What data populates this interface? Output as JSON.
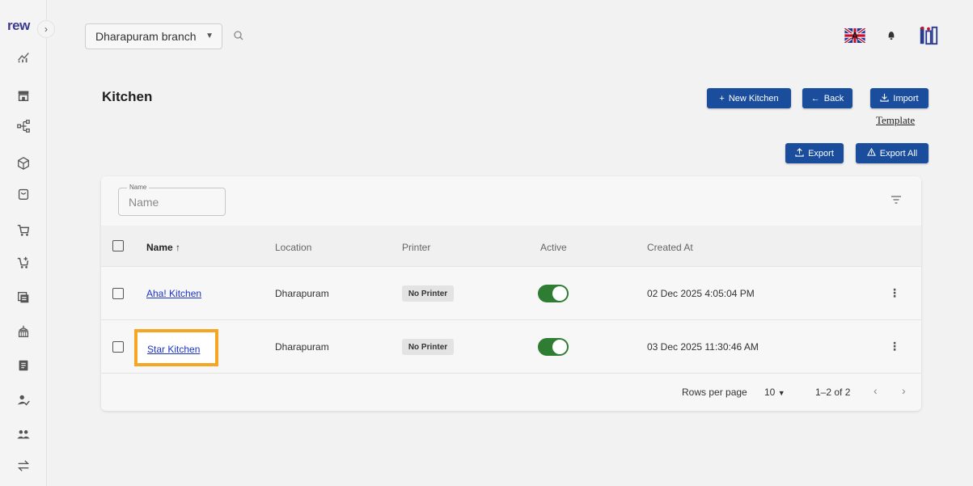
{
  "app": {
    "logo": "rew"
  },
  "sidebar": {
    "expand_icon": "chevron-right-icon",
    "items": [
      {
        "icon": "analytics-icon"
      },
      {
        "icon": "store-icon"
      },
      {
        "icon": "hierarchy-icon"
      },
      {
        "icon": "box-icon"
      },
      {
        "icon": "bag-icon"
      },
      {
        "icon": "cart-icon"
      },
      {
        "icon": "cart-add-icon"
      },
      {
        "icon": "layers-icon"
      },
      {
        "icon": "tiffin-icon"
      },
      {
        "icon": "receipt-icon"
      },
      {
        "icon": "user-check-icon"
      },
      {
        "icon": "users-icon"
      },
      {
        "icon": "swap-icon"
      }
    ]
  },
  "topbar": {
    "branch": "Dharapuram branch",
    "language_icon": "uk-flag-icon",
    "notification_icon": "bell-icon",
    "brand_icon": "brand-logo-icon"
  },
  "page": {
    "title": "Kitchen",
    "buttons": {
      "new_kitchen": "New Kitchen",
      "back": "Back",
      "import": "Import",
      "template": "Template",
      "export": "Export",
      "export_all": "Export All"
    }
  },
  "filter": {
    "legend": "Name",
    "placeholder": "Name"
  },
  "table": {
    "columns": {
      "name": "Name ↑",
      "location": "Location",
      "printer": "Printer",
      "active": "Active",
      "created_at": "Created At"
    },
    "rows": [
      {
        "name": "Aha! Kitchen",
        "location": "Dharapuram",
        "printer": "No Printer",
        "active": true,
        "created_at": "02 Dec 2025 4:05:04 PM"
      },
      {
        "name": "Star Kitchen",
        "location": "Dharapuram",
        "printer": "No Printer",
        "active": true,
        "created_at": "03 Dec 2025 11:30:46 AM"
      }
    ]
  },
  "pagination": {
    "rows_per_page_label": "Rows per page",
    "rows_per_page_value": "10",
    "range": "1–2 of 2"
  },
  "colors": {
    "primary": "#1a4d9c",
    "toggle_on": "#2e7d32",
    "link": "#1d34c9",
    "highlight": "#f5a623"
  }
}
